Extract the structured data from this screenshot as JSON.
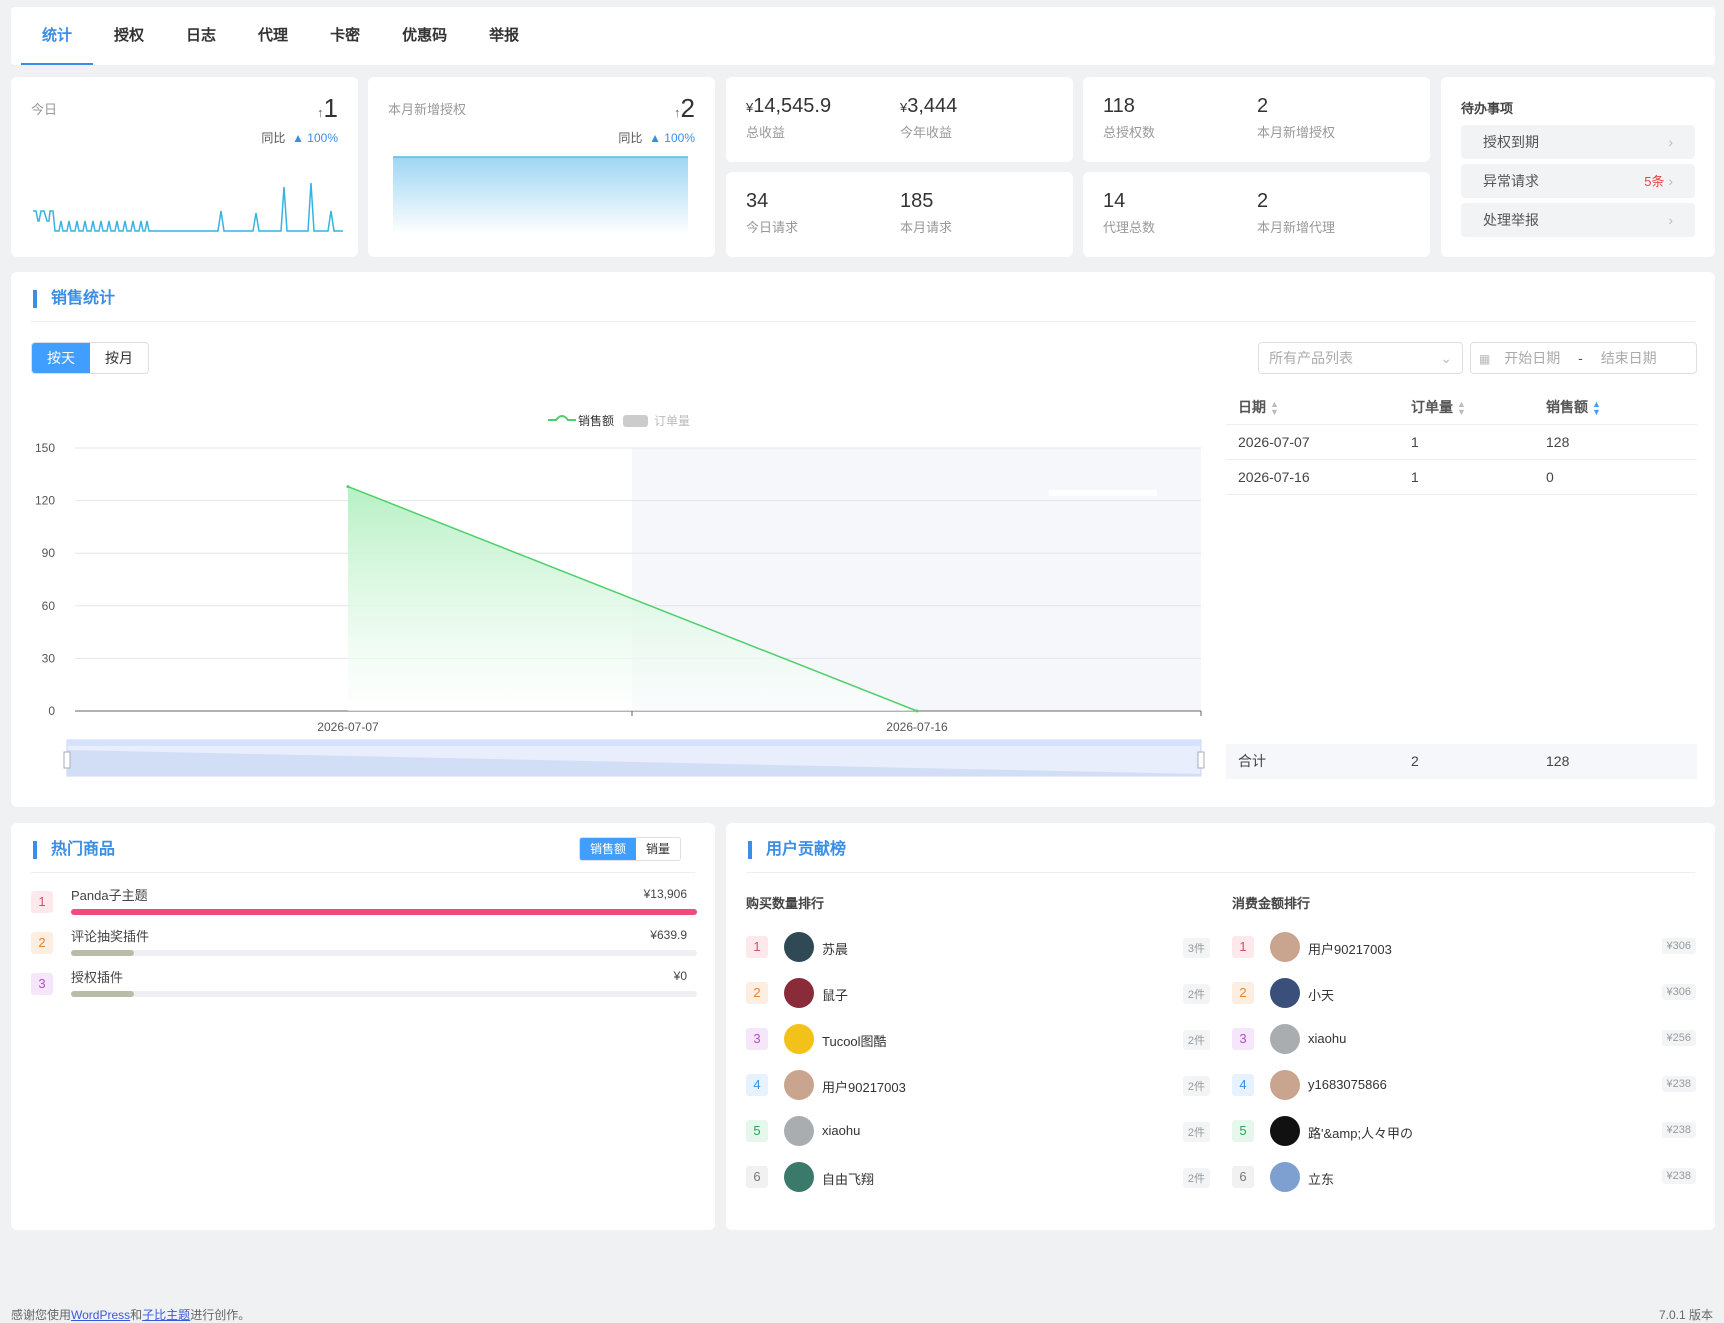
{
  "tabs": [
    "统计",
    "授权",
    "日志",
    "代理",
    "卡密",
    "优惠码",
    "举报"
  ],
  "today": {
    "label": "今日",
    "value": "1",
    "compare_label": "同比",
    "compare_value": "100%"
  },
  "monthly_auth": {
    "label": "本月新增授权",
    "value": "2",
    "compare_label": "同比",
    "compare_value": "100%"
  },
  "income": {
    "total": "14,545.9",
    "total_label": "总收益",
    "year": "3,444",
    "year_label": "今年收益",
    "currency": "¥"
  },
  "auth": {
    "total": "118",
    "total_label": "总授权数",
    "month": "2",
    "month_label": "本月新增授权"
  },
  "requests": {
    "today": "34",
    "today_label": "今日请求",
    "month": "185",
    "month_label": "本月请求"
  },
  "agents": {
    "total": "14",
    "total_label": "代理总数",
    "month": "2",
    "month_label": "本月新增代理"
  },
  "todo": {
    "title": "待办事项",
    "items": [
      {
        "label": "授权到期",
        "badge": ""
      },
      {
        "label": "异常请求",
        "badge": "5条"
      },
      {
        "label": "处理举报",
        "badge": ""
      }
    ]
  },
  "sales": {
    "title": "销售统计",
    "by_day": "按天",
    "by_month": "按月",
    "product_placeholder": "所有产品列表",
    "start_date": "开始日期",
    "date_sep": "-",
    "end_date": "结束日期",
    "legend_amount": "销售额",
    "legend_orders": "订单量"
  },
  "chart_data": {
    "type": "area",
    "x": [
      "2026-07-07",
      "2026-07-16"
    ],
    "series": [
      {
        "name": "销售额",
        "values": [
          128,
          0
        ]
      },
      {
        "name": "订单量",
        "values": [
          1,
          1
        ]
      }
    ],
    "ylim": [
      0,
      150
    ],
    "yticks": [
      0,
      30,
      60,
      90,
      120,
      150
    ],
    "legend_position": "top-center",
    "grid": true
  },
  "sales_table": {
    "headers": [
      "日期",
      "订单量",
      "销售额"
    ],
    "rows": [
      [
        "2026-07-07",
        "1",
        "128"
      ],
      [
        "2026-07-16",
        "1",
        "0"
      ]
    ],
    "total_label": "合计",
    "total_orders": "2",
    "total_amount": "128"
  },
  "hot": {
    "title": "热门商品",
    "tab_amount": "销售额",
    "tab_count": "销量",
    "items": [
      {
        "rank": "1",
        "name": "Panda子主题",
        "amount": "¥13,906",
        "pct": 1.0,
        "color": "#ee4d7b"
      },
      {
        "rank": "2",
        "name": "评论抽奖插件",
        "amount": "¥639.9",
        "pct": 0.1,
        "color": "#b9bca6"
      },
      {
        "rank": "3",
        "name": "授权插件",
        "amount": "¥0",
        "pct": 0.1,
        "color": "#b9bca6"
      }
    ]
  },
  "contrib": {
    "title": "用户贡献榜",
    "buy_title": "购买数量排行",
    "spend_title": "消费金额排行",
    "buy": [
      {
        "rank": "1",
        "name": "苏晨",
        "value": "3件",
        "color": "#2f4a55"
      },
      {
        "rank": "2",
        "name": "鼠子",
        "value": "2件",
        "color": "#8a2b3a"
      },
      {
        "rank": "3",
        "name": "Tucool图酷",
        "value": "2件",
        "color": "#f2c21b"
      },
      {
        "rank": "4",
        "name": "用户90217003",
        "value": "2件",
        "color": "#c9a58f"
      },
      {
        "rank": "5",
        "name": "xiaohu",
        "value": "2件",
        "color": "#a9adb0"
      },
      {
        "rank": "6",
        "name": "自由飞翔",
        "value": "2件",
        "color": "#3b7a6a"
      }
    ],
    "spend": [
      {
        "rank": "1",
        "name": "用户90217003",
        "value": "¥306",
        "color": "#c9a58f"
      },
      {
        "rank": "2",
        "name": "小天",
        "value": "¥306",
        "color": "#3a4f7a"
      },
      {
        "rank": "3",
        "name": "xiaohu",
        "value": "¥256",
        "color": "#a9adb0"
      },
      {
        "rank": "4",
        "name": "y1683075866",
        "value": "¥238",
        "color": "#c9a58f"
      },
      {
        "rank": "5",
        "name": "路'&amp;人々甲の",
        "value": "¥238",
        "color": "#111111"
      },
      {
        "rank": "6",
        "name": "立东",
        "value": "¥238",
        "color": "#7da0d0"
      }
    ]
  },
  "footer": {
    "text1": "感谢您使用",
    "link1": "WordPress",
    "text2": "和",
    "link2": "子比主题",
    "text3": "进行创作。",
    "version": "7.0.1 版本"
  }
}
